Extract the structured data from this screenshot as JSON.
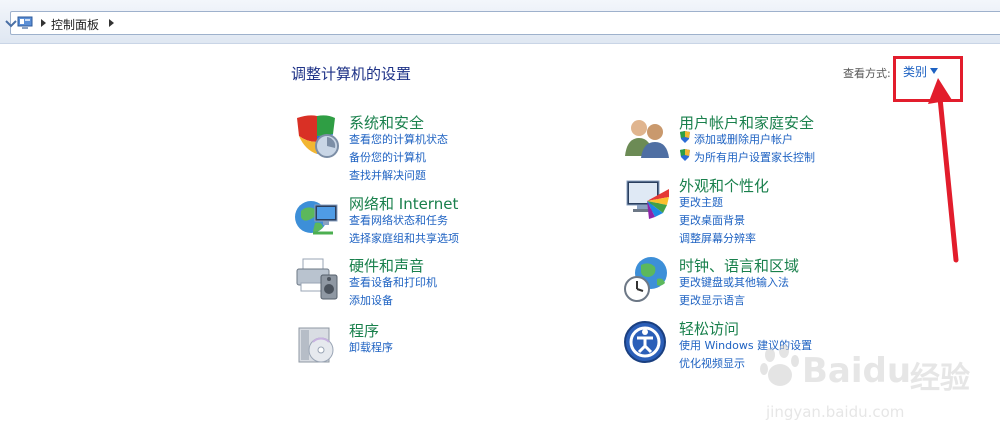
{
  "address": {
    "path": "控制面板"
  },
  "header": {
    "title": "调整计算机的设置",
    "view_label": "查看方式:",
    "view_value": "类别"
  },
  "categories": [
    {
      "title": "系统和安全",
      "links": [
        "查看您的计算机状态",
        "备份您的计算机",
        "查找并解决问题"
      ]
    },
    {
      "title": "网络和 Internet",
      "links": [
        "查看网络状态和任务",
        "选择家庭组和共享选项"
      ]
    },
    {
      "title": "硬件和声音",
      "links": [
        "查看设备和打印机",
        "添加设备"
      ]
    },
    {
      "title": "程序",
      "links": [
        "卸载程序"
      ]
    },
    {
      "title": "用户帐户和家庭安全",
      "links": [
        "添加或删除用户帐户",
        "为所有用户设置家长控制"
      ]
    },
    {
      "title": "外观和个性化",
      "links": [
        "更改主题",
        "更改桌面背景",
        "调整屏幕分辨率"
      ]
    },
    {
      "title": "时钟、语言和区域",
      "links": [
        "更改键盘或其他输入法",
        "更改显示语言"
      ]
    },
    {
      "title": "轻松访问",
      "links": [
        "使用 Windows 建议的设置",
        "优化视频显示"
      ]
    }
  ],
  "watermark": {
    "brand": "Baidu",
    "brand_cn": "经验",
    "url": "jingyan.baidu.com"
  },
  "colors": {
    "title": "#1e3287",
    "category": "#19804c",
    "link": "#1e62c2",
    "highlight": "#e21d2c"
  }
}
